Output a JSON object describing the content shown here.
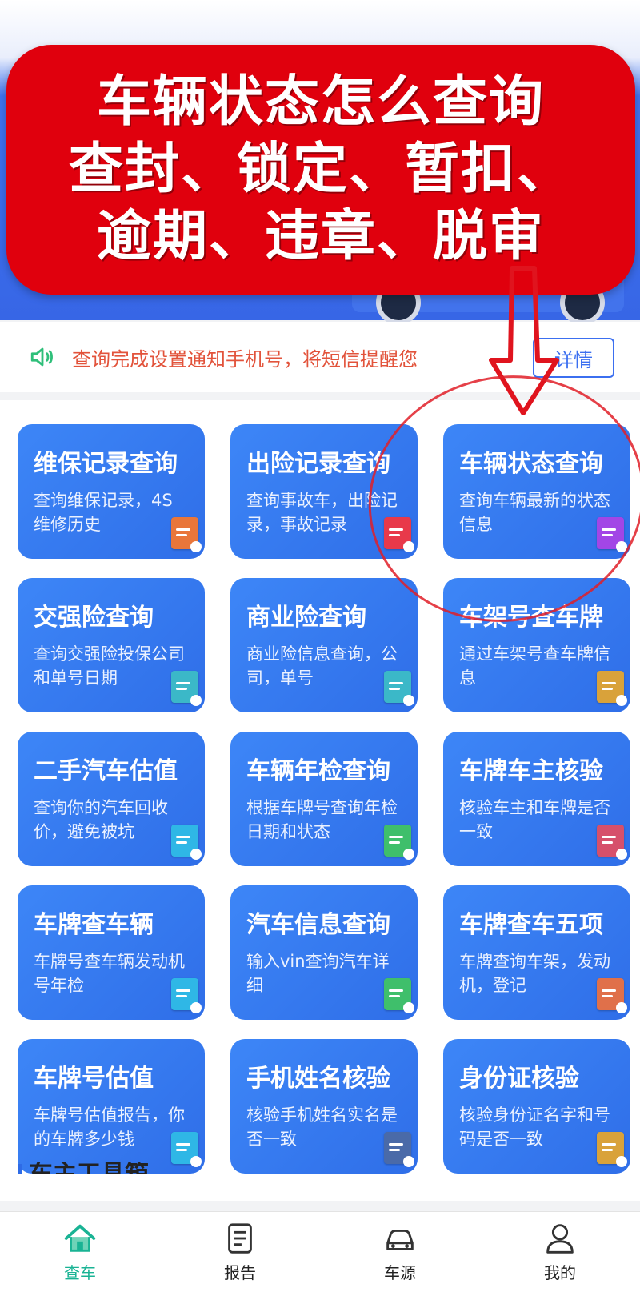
{
  "overlay": {
    "line1": "车辆状态怎么查询",
    "line2": "查封、锁定、暂扣、",
    "line3": "逾期、违章、脱审"
  },
  "notice": {
    "text": "查询完成设置通知手机号，将短信提醒您",
    "button_label": "详情"
  },
  "cards": [
    {
      "title": "维保记录查询",
      "desc": "查询维保记录，4S维修历史",
      "icon_color": "#e9763a",
      "icon": "document-icon"
    },
    {
      "title": "出险记录查询",
      "desc": "查询事故车，出险记录，事故记录",
      "icon_color": "#e8394a",
      "icon": "document-icon"
    },
    {
      "title": "车辆状态查询",
      "desc": "查询车辆最新的状态信息",
      "icon_color": "#a246e6",
      "icon": "document-icon"
    },
    {
      "title": "交强险查询",
      "desc": "查询交强险投保公司和单号日期",
      "icon_color": "#3bb8c8",
      "icon": "document-icon"
    },
    {
      "title": "商业险查询",
      "desc": "商业险信息查询，公司，单号",
      "icon_color": "#3bb8c8",
      "icon": "document-icon"
    },
    {
      "title": "车架号查车牌",
      "desc": "通过车架号查车牌信息",
      "icon_color": "#d9a23a",
      "icon": "document-icon"
    },
    {
      "title": "二手汽车估值",
      "desc": "查询你的汽车回收价，避免被坑",
      "icon_color": "#2fb7e6",
      "icon": "document-icon"
    },
    {
      "title": "车辆年检查询",
      "desc": "根据车牌号查询年检日期和状态",
      "icon_color": "#3fbf6b",
      "icon": "document-icon"
    },
    {
      "title": "车牌车主核验",
      "desc": "核验车主和车牌是否一致",
      "icon_color": "#d6506b",
      "icon": "document-icon"
    },
    {
      "title": "车牌查车辆",
      "desc": "车牌号查车辆发动机号年检",
      "icon_color": "#2fb7e6",
      "icon": "document-icon"
    },
    {
      "title": "汽车信息查询",
      "desc": "输入vin查询汽车详细",
      "icon_color": "#3fbf6b",
      "icon": "document-icon"
    },
    {
      "title": "车牌查车五项",
      "desc": "车牌查询车架，发动机，登记",
      "icon_color": "#e0704a",
      "icon": "document-icon"
    },
    {
      "title": "车牌号估值",
      "desc": "车牌号估值报告，你的车牌多少钱",
      "icon_color": "#2fb7e6",
      "icon": "document-icon"
    },
    {
      "title": "手机姓名核验",
      "desc": "核验手机姓名实名是否一致",
      "icon_color": "#4a6aa8",
      "icon": "document-icon"
    },
    {
      "title": "身份证核验",
      "desc": "核验身份证名字和号码是否一致",
      "icon_color": "#d9a23a",
      "icon": "document-icon"
    }
  ],
  "section_title": "车主工具箱",
  "tabs": [
    {
      "label": "查车",
      "icon": "home-icon",
      "active": true
    },
    {
      "label": "报告",
      "icon": "report-icon",
      "active": false
    },
    {
      "label": "车源",
      "icon": "car-icon",
      "active": false
    },
    {
      "label": "我的",
      "icon": "user-icon",
      "active": false
    }
  ],
  "colors": {
    "accent": "#2f6ee8",
    "overlay_red": "#e0000d",
    "tab_active": "#19b394",
    "notice_text": "#e2533b"
  }
}
